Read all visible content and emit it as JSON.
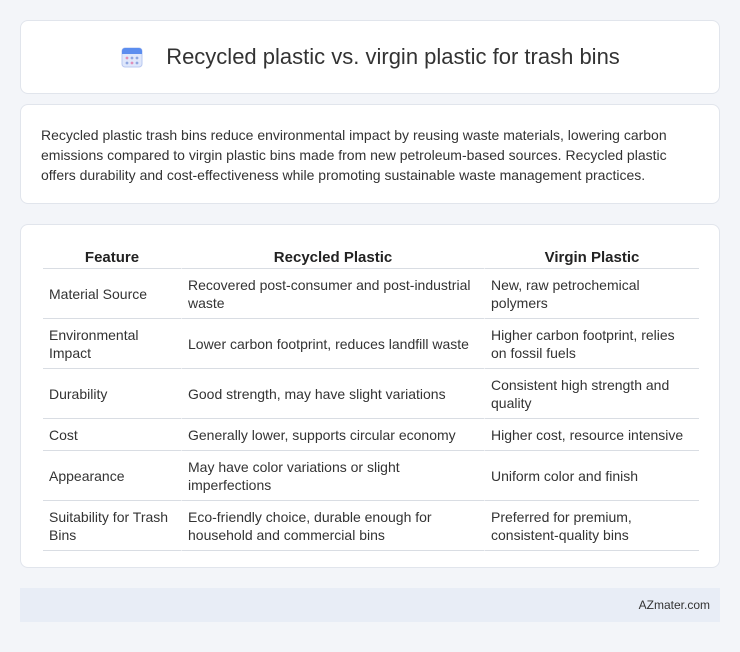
{
  "header": {
    "title": "Recycled plastic vs. virgin plastic for trash bins",
    "icon": "calendar-icon"
  },
  "intro": {
    "text": "Recycled plastic trash bins reduce environmental impact by reusing waste materials, lowering carbon emissions compared to virgin plastic bins made from new petroleum-based sources. Recycled plastic offers durability and cost-effectiveness while promoting sustainable waste management practices."
  },
  "table": {
    "headers": [
      "Feature",
      "Recycled Plastic",
      "Virgin Plastic"
    ],
    "rows": [
      [
        "Material Source",
        "Recovered post-consumer and post-industrial waste",
        "New, raw petrochemical polymers"
      ],
      [
        "Environmental Impact",
        "Lower carbon footprint, reduces landfill waste",
        "Higher carbon footprint, relies on fossil fuels"
      ],
      [
        "Durability",
        "Good strength, may have slight variations",
        "Consistent high strength and quality"
      ],
      [
        "Cost",
        "Generally lower, supports circular economy",
        "Higher cost, resource intensive"
      ],
      [
        "Appearance",
        "May have color variations or slight imperfections",
        "Uniform color and finish"
      ],
      [
        "Suitability for Trash Bins",
        "Eco-friendly choice, durable enough for household and commercial bins",
        "Preferred for premium, consistent-quality bins"
      ]
    ]
  },
  "footer": {
    "site": "AZmater.com"
  },
  "colors": {
    "background": "#f3f5f9",
    "card": "#ffffff",
    "footer": "#e8edf6",
    "icon_accent": "#5b8def"
  }
}
